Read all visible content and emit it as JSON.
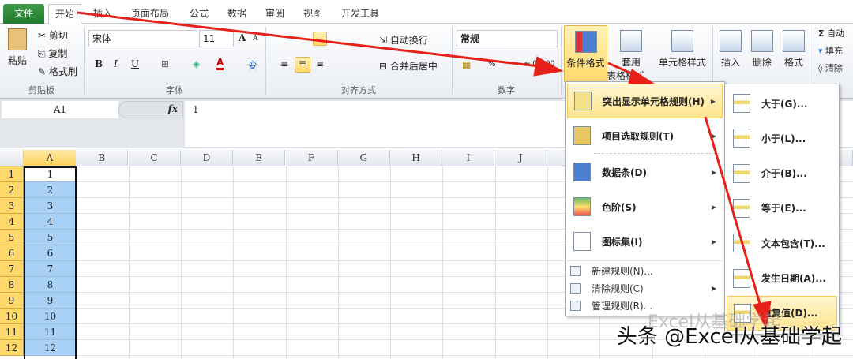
{
  "tabs": {
    "file": "文件",
    "home": "开始",
    "items": [
      "插入",
      "页面布局",
      "公式",
      "数据",
      "审阅",
      "视图",
      "开发工具"
    ]
  },
  "ribbon": {
    "clipboard": {
      "paste": "粘贴",
      "cut": "剪切",
      "copy": "复制",
      "format_painter": "格式刷",
      "label": "剪贴板"
    },
    "font": {
      "name": "宋体",
      "size": "11",
      "bold": "B",
      "italic": "I",
      "underline": "U",
      "grow": "A",
      "shrink": "A",
      "color": "A",
      "phonetic": "变",
      "label": "字体"
    },
    "alignment": {
      "wrap": "自动换行",
      "merge": "合并后居中",
      "label": "对齐方式"
    },
    "number": {
      "format": "常规",
      "percent": "%",
      "dec_inc": "←.0",
      "dec_dec": ".00",
      "label": "数字"
    },
    "styles": {
      "conditional": "条件格式",
      "table_fmt_1": "套用",
      "table_fmt_2": "表格格式",
      "cell_styles": "单元格样式"
    },
    "cells": {
      "insert": "插入",
      "delete": "删除",
      "format": "格式"
    },
    "editing": {
      "autosum": "自动",
      "fill": "填充",
      "clear": "清除",
      "sigma": "Σ"
    }
  },
  "formula_bar": {
    "name_box": "A1",
    "fx": "fx",
    "value": "1"
  },
  "columns": [
    "A",
    "B",
    "C",
    "D",
    "E",
    "F",
    "G",
    "H",
    "I",
    "J"
  ],
  "rows": [
    "1",
    "2",
    "3",
    "4",
    "5",
    "6",
    "7",
    "8",
    "9",
    "10",
    "11",
    "12"
  ],
  "cells_a": [
    "1",
    "2",
    "3",
    "4",
    "5",
    "6",
    "7",
    "8",
    "9",
    "10",
    "11",
    "12"
  ],
  "cf_menu": {
    "items": [
      "突出显示单元格规则(H)",
      "项目选取规则(T)",
      "数据条(D)",
      "色阶(S)",
      "图标集(I)"
    ],
    "small": [
      "新建规则(N)...",
      "清除规则(C)",
      "管理规则(R)..."
    ]
  },
  "sub_menu": {
    "items": [
      "大于(G)...",
      "小于(L)...",
      "介于(B)...",
      "等于(E)...",
      "文本包含(T)...",
      "发生日期(A)...",
      "重复值(D)..."
    ]
  },
  "watermark": {
    "main": "头条 @Excel从基础学起",
    "faint": "Excel从基础学起"
  },
  "colors": {
    "accent": "#ffd86b",
    "selection": "#a9d0f5",
    "arrow": "#e8201a"
  }
}
